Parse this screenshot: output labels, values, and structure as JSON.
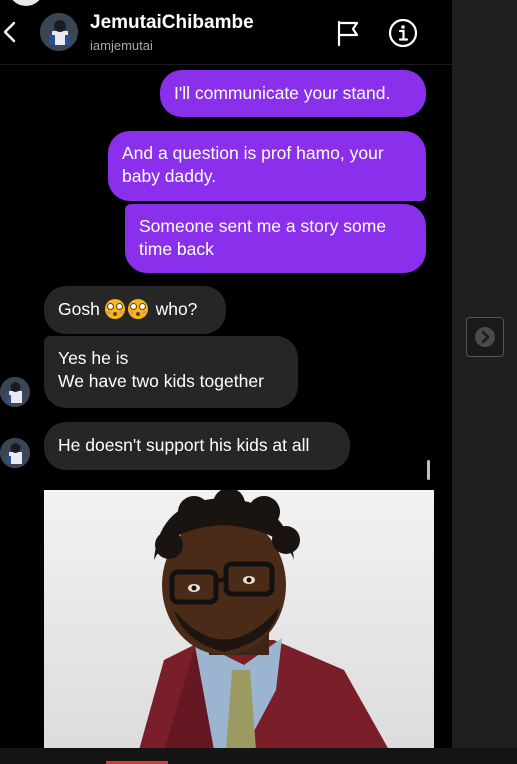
{
  "header": {
    "name": "JemutaiChibambe",
    "handle": "iamjemutai"
  },
  "messages": [
    {
      "from": "me",
      "text": "I'll communicate your stand."
    },
    {
      "from": "me",
      "line1": "And a question is prof hamo, your",
      "line2": "baby daddy."
    },
    {
      "from": "me",
      "line1": "Someone sent me a story some",
      "line2": "time back"
    },
    {
      "from": "them",
      "text_before": "Gosh",
      "emoji": "flushed-face",
      "text_after": "who?"
    },
    {
      "from": "them",
      "line1": "Yes he is",
      "line2": "We have two kids together"
    },
    {
      "from": "them",
      "text": "He doesn't support his kids at all"
    },
    {
      "from": "them",
      "type": "image",
      "description_icon": "photo-message"
    }
  ],
  "icons": {
    "back": "chevron-left-icon",
    "report": "flag-icon",
    "info": "info-icon",
    "next": "chevron-right-icon"
  },
  "colors": {
    "sent_bubble": "#8a30ec",
    "received_bubble": "#262626",
    "background": "#000000"
  }
}
